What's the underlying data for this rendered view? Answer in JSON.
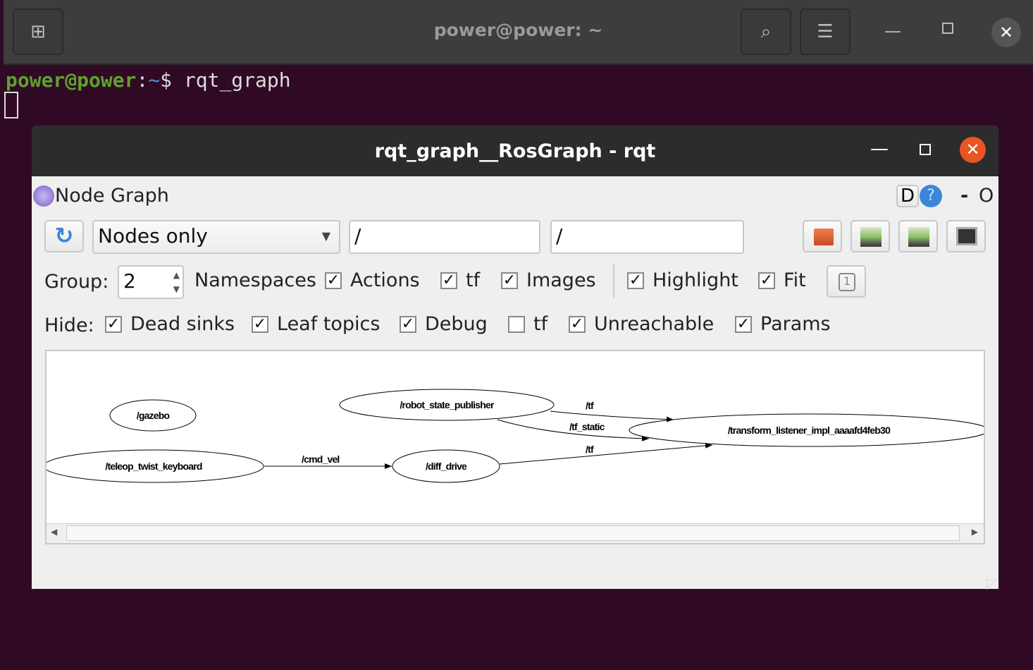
{
  "terminal": {
    "title": "power@power: ~",
    "prompt_user": "power@power",
    "prompt_sep": ":",
    "prompt_path": "~",
    "prompt_symbol": "$",
    "command": "rqt_graph",
    "icons": [
      "new-tab-icon",
      "search-icon",
      "hamburger-menu-icon",
      "minimize-icon",
      "maximize-icon",
      "close-icon"
    ]
  },
  "window": {
    "title": "rqt_graph__RosGraph - rqt",
    "plugin": {
      "title": "Node Graph",
      "d_label": "D",
      "help_label": "?",
      "minus_label": "-",
      "o_label": "O"
    },
    "toolbar": {
      "graph_mode": "Nodes only",
      "node_filter": "/",
      "topic_filter": "/"
    },
    "group": {
      "label": "Group:",
      "value": "2"
    },
    "options": [
      {
        "label": "Namespaces",
        "checked": true
      },
      {
        "label": "Actions",
        "checked": true
      },
      {
        "label": "tf",
        "checked": true
      },
      {
        "label": "Images",
        "checked": true
      },
      {
        "label": "Highlight",
        "checked": true
      },
      {
        "label": "Fit",
        "checked": true
      }
    ],
    "hide": {
      "label": "Hide:",
      "items": [
        {
          "label": "Dead sinks",
          "checked": true
        },
        {
          "label": "Leaf topics",
          "checked": true
        },
        {
          "label": "Debug",
          "checked": true
        },
        {
          "label": "tf",
          "checked": false
        },
        {
          "label": "Unreachable",
          "checked": true
        },
        {
          "label": "Params",
          "checked": true
        }
      ]
    },
    "graph": {
      "nodes": [
        "/gazebo",
        "/teleop_twist_keyboard",
        "/robot_state_publisher",
        "/diff_drive",
        "/transform_listener_impl_aaaafd4feb30"
      ],
      "edges": [
        {
          "from": "/teleop_twist_keyboard",
          "to": "/diff_drive",
          "label": "/cmd_vel"
        },
        {
          "from": "/robot_state_publisher",
          "to": "/transform_listener_impl_aaaafd4feb30",
          "label": "/tf"
        },
        {
          "from": "/robot_state_publisher",
          "to": "/transform_listener_impl_aaaafd4feb30",
          "label": "/tf_static"
        },
        {
          "from": "/diff_drive",
          "to": "/transform_listener_impl_aaaafd4feb30",
          "label": "/tf"
        }
      ]
    }
  }
}
